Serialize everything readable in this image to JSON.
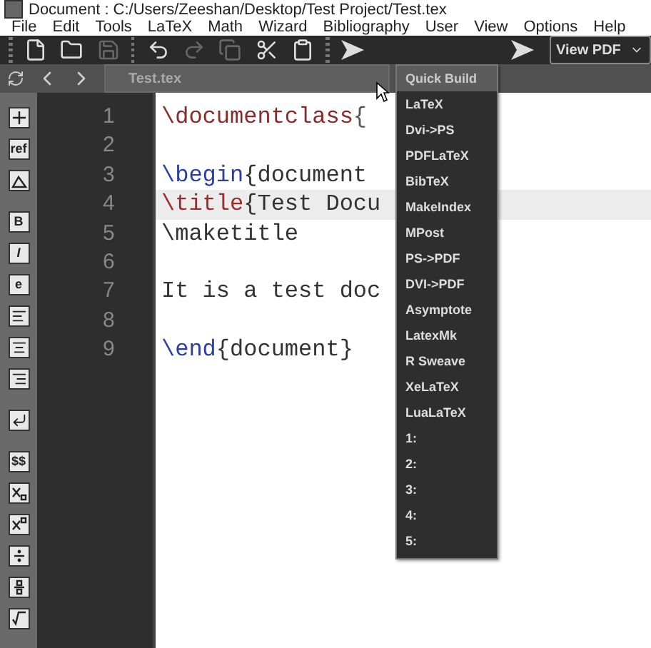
{
  "window": {
    "title": "Document : C:/Users/Zeeshan/Desktop/Test Project/Test.tex"
  },
  "menu": [
    "File",
    "Edit",
    "Tools",
    "LaTeX",
    "Math",
    "Wizard",
    "Bibliography",
    "User",
    "View",
    "Options",
    "Help"
  ],
  "toolbar": [
    {
      "kind": "grip"
    },
    {
      "kind": "new",
      "disabled": false
    },
    {
      "kind": "open",
      "disabled": false
    },
    {
      "kind": "save",
      "disabled": true
    },
    {
      "kind": "grip"
    },
    {
      "kind": "undo",
      "disabled": false
    },
    {
      "kind": "redo",
      "disabled": true
    },
    {
      "kind": "copy",
      "disabled": true
    },
    {
      "kind": "cut",
      "disabled": false
    },
    {
      "kind": "paste",
      "disabled": false
    },
    {
      "kind": "grip"
    },
    {
      "kind": "run",
      "disabled": false
    }
  ],
  "build_menu": {
    "items": [
      {
        "label": "Quick Build",
        "selected": true
      },
      {
        "label": "LaTeX",
        "selected": false
      },
      {
        "label": "Dvi->PS",
        "selected": false
      },
      {
        "label": "PDFLaTeX",
        "selected": false
      },
      {
        "label": "BibTeX",
        "selected": false
      },
      {
        "label": "MakeIndex",
        "selected": false
      },
      {
        "label": "MPost",
        "selected": false
      },
      {
        "label": "PS->PDF",
        "selected": false
      },
      {
        "label": "DVI->PDF",
        "selected": false
      },
      {
        "label": "Asymptote",
        "selected": false
      },
      {
        "label": "LatexMk",
        "selected": false
      },
      {
        "label": "R Sweave",
        "selected": false
      },
      {
        "label": "XeLaTeX",
        "selected": false
      },
      {
        "label": "LuaLaTeX",
        "selected": false
      },
      {
        "label": "1:",
        "selected": false
      },
      {
        "label": "2:",
        "selected": false
      },
      {
        "label": "3:",
        "selected": false
      },
      {
        "label": "4:",
        "selected": false
      },
      {
        "label": "5:",
        "selected": false
      }
    ]
  },
  "view_select": {
    "value": "View PDF"
  },
  "tab": {
    "label": "Test.tex"
  },
  "sidebar": [
    {
      "tools": [
        {
          "kind": "insert"
        },
        {
          "kind": "text",
          "label": "ref"
        },
        {
          "kind": "image"
        }
      ]
    },
    {
      "tools": [
        {
          "kind": "text",
          "label": "B"
        },
        {
          "kind": "italic",
          "label": "I"
        },
        {
          "kind": "text",
          "label": "e"
        },
        {
          "kind": "align-left"
        },
        {
          "kind": "align-center"
        },
        {
          "kind": "align-right"
        }
      ]
    },
    {
      "tools": [
        {
          "kind": "return"
        }
      ]
    },
    {
      "tools": [
        {
          "kind": "text",
          "label": "$$"
        },
        {
          "kind": "subscript"
        },
        {
          "kind": "superscript"
        },
        {
          "kind": "divide"
        },
        {
          "kind": "fraction"
        },
        {
          "kind": "root"
        }
      ]
    }
  ],
  "editor": {
    "lines": [
      {
        "number": "1",
        "highlighted": false,
        "tokens": [
          {
            "text": "\\documentclass",
            "color": "#8b2a2a"
          },
          {
            "text": "{",
            "color": "#555555"
          }
        ]
      },
      {
        "number": "2",
        "highlighted": false
      },
      {
        "number": "3",
        "highlighted": false,
        "tokens": [
          {
            "text": "\\begin",
            "color": "#2a3fa0"
          },
          {
            "text": "{document",
            "color": "#333333"
          }
        ]
      },
      {
        "number": "4",
        "highlighted": true,
        "tokens": [
          {
            "text": "\\title",
            "color": "#a02a2a"
          },
          {
            "text": "{Test Docu",
            "color": "#333333"
          }
        ]
      },
      {
        "number": "5",
        "highlighted": false,
        "tokens": [
          {
            "text": "\\maketitle",
            "color": "#333333"
          }
        ]
      },
      {
        "number": "6",
        "highlighted": false
      },
      {
        "number": "7",
        "highlighted": false,
        "tokens": [
          {
            "text": "It is a test doc",
            "color": "#333333"
          }
        ]
      },
      {
        "number": "8",
        "highlighted": false
      },
      {
        "number": "9",
        "highlighted": false,
        "tokens": [
          {
            "text": "\\end",
            "color": "#2a3fa0"
          },
          {
            "text": "{document}",
            "color": "#333333"
          }
        ]
      }
    ]
  }
}
